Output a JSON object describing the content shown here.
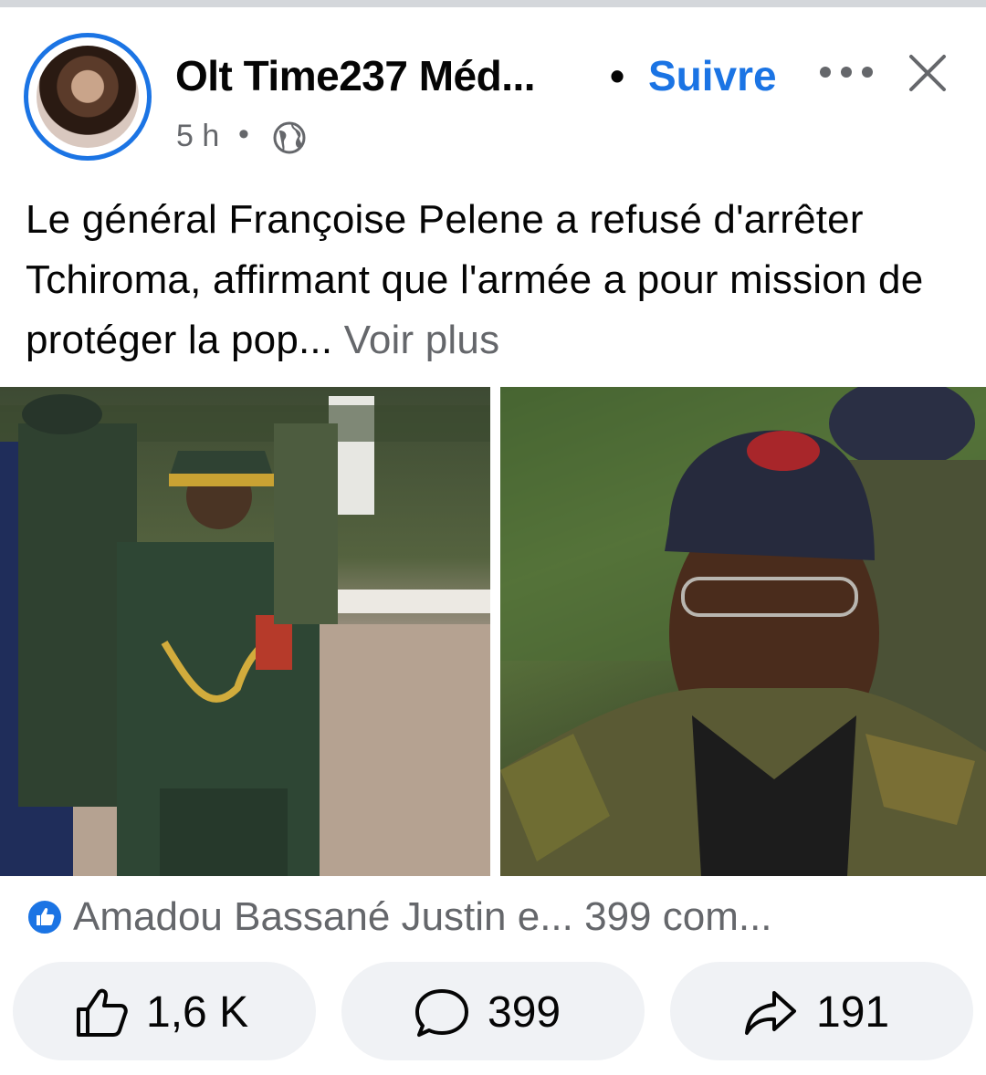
{
  "post": {
    "page_name": "Olt Time237 Méd...",
    "separator": "•",
    "follow_label": "Suivre",
    "time": "5 h",
    "meta_separator": "•",
    "audience_icon": "globe-icon",
    "text": "Le général Françoise Pelene a refusé d'arrêter Tchiroma, affirmant que l'armée a pour mission de protéger la pop...",
    "see_more": "Voir plus"
  },
  "reactions": {
    "icon": "like-badge-icon",
    "summary": "Amadou Bassané Justin e... 399 com..."
  },
  "actions": {
    "like_count": "1,6 K",
    "comment_count": "399",
    "share_count": "191"
  },
  "colors": {
    "accent": "#1b74e4",
    "muted_text": "#65676b",
    "button_bg": "#f0f2f5"
  }
}
